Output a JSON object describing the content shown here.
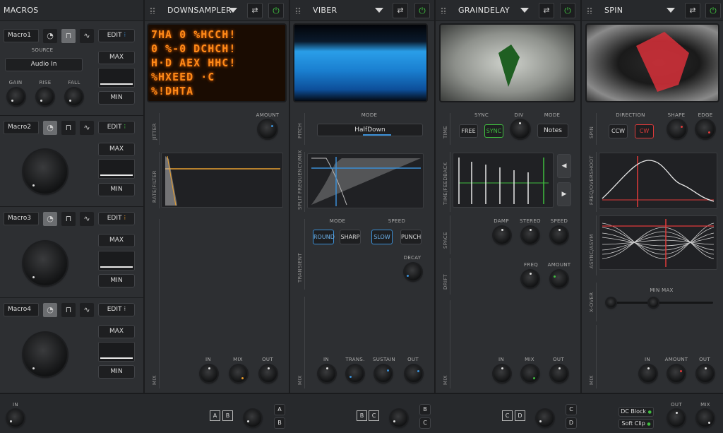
{
  "macros": {
    "title": "MACROS",
    "source_label": "SOURCE",
    "source_value": "Audio In",
    "gain_label": "GAIN",
    "rise_label": "RISE",
    "fall_label": "FALL",
    "edit_label": "EDIT",
    "max_label": "MAX",
    "min_label": "MIN",
    "rows": [
      {
        "name": "Macro1"
      },
      {
        "name": "Macro2"
      },
      {
        "name": "Macro3"
      },
      {
        "name": "Macro4"
      }
    ]
  },
  "downsampler": {
    "title": "DOWNSAMPLER",
    "screen_lines": [
      "7HA 0 %HCCH!",
      "0 %-0 DCHCH!",
      "H·D AEX HHC!",
      "%HXEED ·C",
      "%!DHTA"
    ],
    "jitter_label": "JITTER",
    "amount_label": "AMOUNT",
    "rate_filter_label": "RATE/FILTER",
    "mix_section_label": "MIX",
    "in_label": "IN",
    "mix_label": "MIX",
    "out_label": "OUT"
  },
  "viber": {
    "title": "VIBER",
    "pitch_label": "PITCH",
    "mode_label": "MODE",
    "mode_value": "HalfDown",
    "split_label": "SPLIT FREQUENCY/MIX",
    "transient_label": "TRANSIENT",
    "mode2_label": "MODE",
    "speed_label": "SPEED",
    "round_label": "ROUND",
    "sharp_label": "SHARP",
    "slow_label": "SLOW",
    "punch_label": "PUNCH",
    "decay_label": "DECAY",
    "mix_section_label": "MIX",
    "in_label": "IN",
    "trans_label": "TRANS.",
    "sustain_label": "SUSTAIN",
    "out_label": "OUT"
  },
  "graindelay": {
    "title": "GRAINDELAY",
    "time_label": "TIME",
    "sync_label": "SYNC",
    "div_label": "DIV",
    "mode_label": "MODE",
    "free_label": "FREE",
    "sync_btn_label": "SYNC",
    "notes_label": "Notes",
    "time_feedback_label": "TIME/FEEDBACK",
    "space_label": "SPACE",
    "damp_label": "DAMP",
    "stereo_label": "STEREO",
    "speed_label": "SPEED",
    "drift_label": "DRIFT",
    "freq_label": "FREQ",
    "amount_label": "AMOUNT",
    "mix_section_label": "MIX",
    "in_label": "IN",
    "mix_label": "MIX",
    "out_label": "OUT"
  },
  "spin": {
    "title": "SPIN",
    "spin_label": "SPIN",
    "direction_label": "DIRECTION",
    "shape_label": "SHAPE",
    "edge_label": "EDGE",
    "ccw_label": "CCW",
    "cw_label": "CW",
    "freq_overshoot_label": "FREQ/OVERSHOOT",
    "async_label": "ASYNC/ASYM",
    "xover_label": "X-OVER",
    "minmax_label": "MIN MAX",
    "mix_section_label": "MIX",
    "in_label": "IN",
    "amount_label": "AMOUNT",
    "out_label": "OUT"
  },
  "footer": {
    "in_label": "IN",
    "ab": [
      "A",
      "B"
    ],
    "bc": [
      "B",
      "C"
    ],
    "cd": [
      "C",
      "D"
    ],
    "dc_block_label": "DC Block",
    "soft_clip_label": "Soft Clip",
    "out_label": "OUT",
    "mix_label": "MIX"
  },
  "colors": {
    "accent_blue": "#3a8fd6",
    "accent_green": "#3fbf3f",
    "accent_red": "#e03a3a",
    "accent_orange": "#e89a2a"
  }
}
